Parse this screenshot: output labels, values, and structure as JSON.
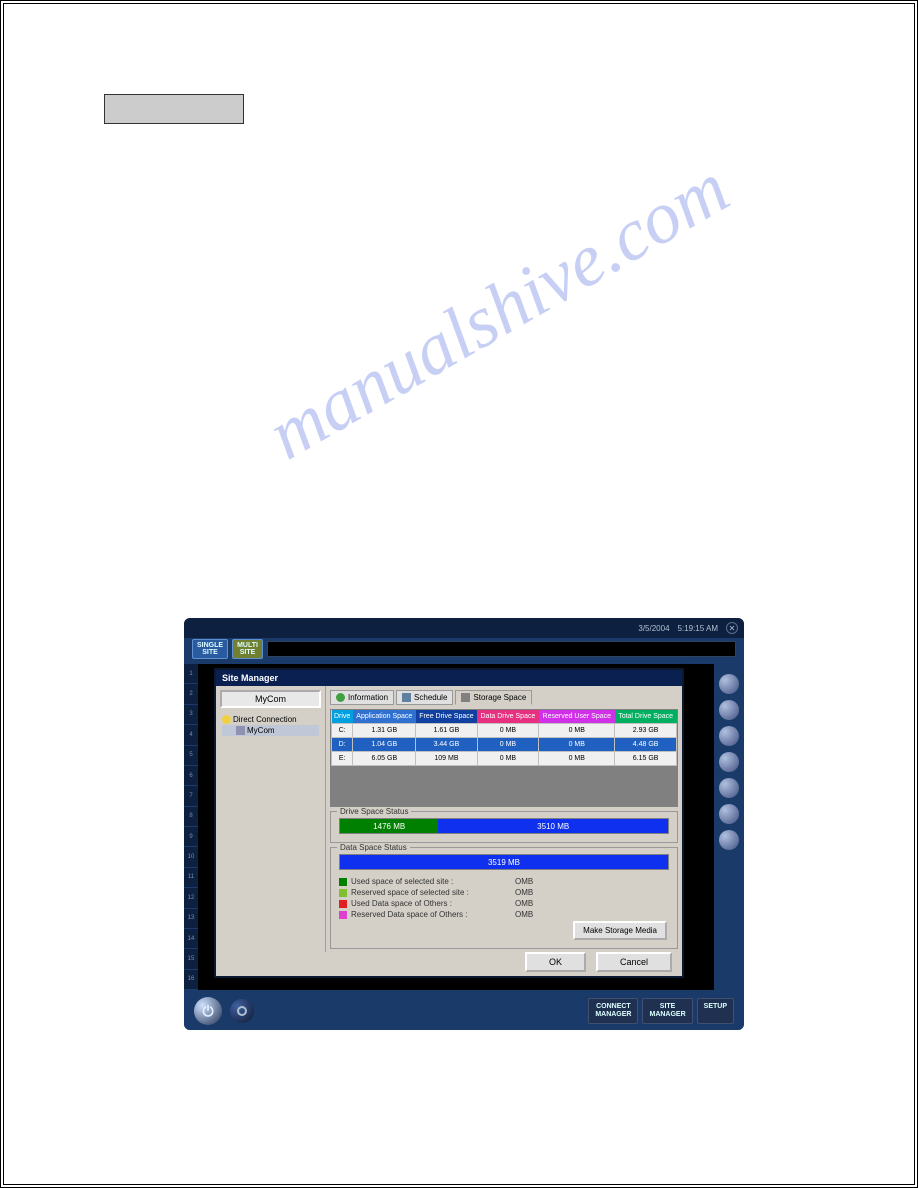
{
  "titlebar": {
    "date": "3/5/2004",
    "time": "5:19:15 AM"
  },
  "mode_buttons": {
    "single": "SINGLE\nSITE",
    "multi": "MULTI\nSITE"
  },
  "channels": [
    "1",
    "2",
    "3",
    "4",
    "5",
    "6",
    "7",
    "8",
    "9",
    "10",
    "11",
    "12",
    "13",
    "14",
    "15",
    "16"
  ],
  "dialog": {
    "title": "Site Manager",
    "combo": "MyCom",
    "tree_root": "Direct Connection",
    "tree_child": "MyCom",
    "tabs": {
      "info": "Information",
      "schedule": "Schedule",
      "storage": "Storage Space"
    },
    "table": {
      "headers": [
        "Drive",
        "Application Space",
        "Free Drive Space",
        "Data Drive Space",
        "Reserved User Space",
        "Total Drive Space"
      ],
      "header_colors": [
        "#00a0e0",
        "#3070d0",
        "#1040a0",
        "#e83080",
        "#d030e8",
        "#00b060"
      ],
      "rows": [
        {
          "cells": [
            "C:",
            "1.31 GB",
            "1.61 GB",
            "0 MB",
            "0 MB",
            "2.93 GB"
          ],
          "sel": false
        },
        {
          "cells": [
            "D:",
            "1.04 GB",
            "3.44 GB",
            "0 MB",
            "0 MB",
            "4.48 GB"
          ],
          "sel": true
        },
        {
          "cells": [
            "E:",
            "6.05 GB",
            "109 MB",
            "0 MB",
            "0 MB",
            "6.15 GB"
          ],
          "sel": false
        }
      ]
    },
    "drive_status": {
      "legend": "Drive Space Status",
      "seg1": {
        "label": "1476 MB",
        "color": "#008000",
        "width": "30%"
      },
      "seg2": {
        "label": "3510 MB",
        "color": "#1030f0",
        "width": "70%"
      }
    },
    "data_status": {
      "legend": "Data Space Status",
      "bar": {
        "label": "3519 MB",
        "color": "#1030f0",
        "width": "100%"
      },
      "legend_rows": [
        {
          "color": "#008000",
          "label": "Used space of selected site :",
          "value": "OMB"
        },
        {
          "color": "#80c030",
          "label": "Reserved space of selected site :",
          "value": "OMB"
        },
        {
          "color": "#e02020",
          "label": "Used Data space of Others :",
          "value": "OMB"
        },
        {
          "color": "#e040d0",
          "label": "Reserved Data space of Others :",
          "value": "OMB"
        }
      ],
      "make_btn": "Make Storage Media"
    },
    "ok": "OK",
    "cancel": "Cancel"
  },
  "bottom": {
    "connect": "CONNECT\nMANAGER",
    "site": "SITE\nMANAGER",
    "setup": "SETUP"
  },
  "watermark": "manualshive.com"
}
